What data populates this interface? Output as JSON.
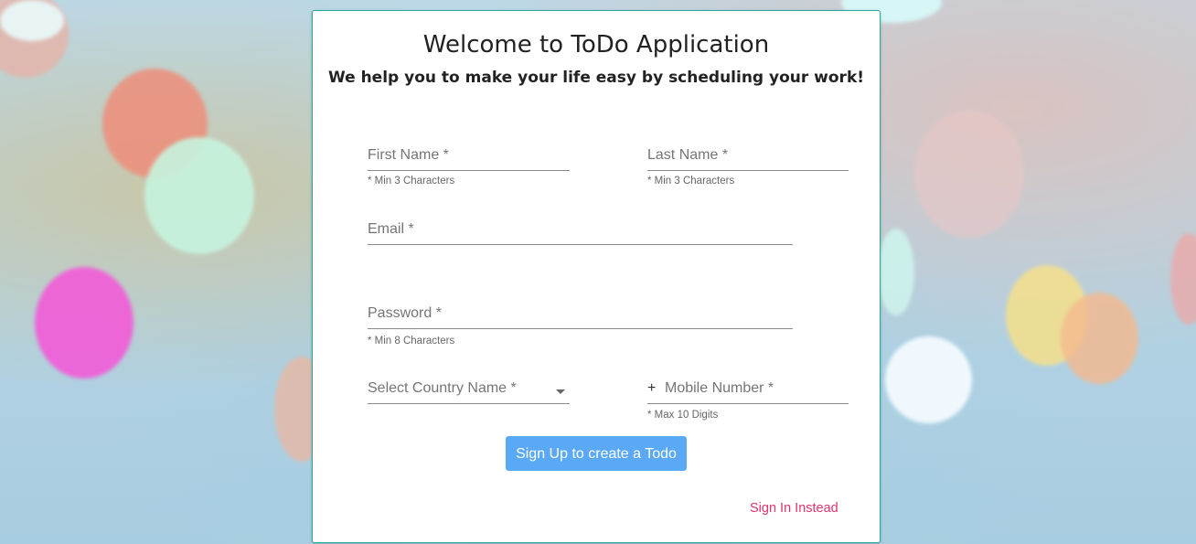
{
  "header": {
    "title": "Welcome to ToDo Application",
    "subtitle": "We help you to make your life easy by scheduling your work!"
  },
  "form": {
    "first_name": {
      "label": "First Name *",
      "helper": "* Min 3 Characters",
      "value": ""
    },
    "last_name": {
      "label": "Last Name *",
      "helper": "* Min 3 Characters",
      "value": ""
    },
    "email": {
      "label": "Email *",
      "value": ""
    },
    "password": {
      "label": "Password *",
      "helper": "* Min 8 Characters",
      "value": ""
    },
    "country": {
      "label": "Select Country Name *",
      "icon": "dropdown-arrow-icon"
    },
    "mobile": {
      "prefix": "+",
      "label": "Mobile Number *",
      "helper": "* Max 10 Digits",
      "value": ""
    },
    "submit_label": "Sign Up to create a Todo",
    "signin_label": "Sign In Instead"
  },
  "colors": {
    "accent": "#5aa9f7",
    "link": "#e0336d",
    "card_border": "#2aa7a0"
  }
}
